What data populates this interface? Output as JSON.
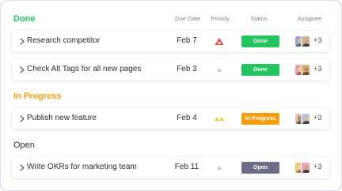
{
  "columns": {
    "due_date": "Due Date",
    "priority": "Priority",
    "status": "Status",
    "assignee": "Assignee"
  },
  "colors": {
    "done_green": "#22c55e",
    "in_progress_orange": "#f59e0b",
    "open_slate": "#6b6c86",
    "priority_high": "#ef4444",
    "priority_medium": "#f4c524",
    "priority_low": "#c4c6d8"
  },
  "groups": [
    {
      "title": "Done",
      "color": "#22c55e",
      "tasks": [
        {
          "name": "Research competitor",
          "due": "Feb 7",
          "priority": "high",
          "priority_icon": "priority-high-icon",
          "status": "Done",
          "assignee_more": "+3"
        },
        {
          "name": "Check Alt Tags for all new pages",
          "due": "Feb 3",
          "priority": "low",
          "priority_icon": "priority-low-icon",
          "status": "Done",
          "assignee_more": "+3"
        }
      ]
    },
    {
      "title": "In Progress",
      "color": "#f59e0b",
      "tasks": [
        {
          "name": "Publish new feature",
          "due": "Feb 4",
          "priority": "medium",
          "priority_icon": "priority-medium-icon",
          "status": "In Progress",
          "assignee_more": "+3"
        }
      ]
    },
    {
      "title": "Open",
      "color": "#2a2c35",
      "tasks": [
        {
          "name": "Write OKRs for marketing team",
          "due": "Feb 11",
          "priority": "low",
          "priority_icon": "priority-low-icon",
          "status": "Open",
          "assignee_more": "+3"
        }
      ]
    }
  ]
}
